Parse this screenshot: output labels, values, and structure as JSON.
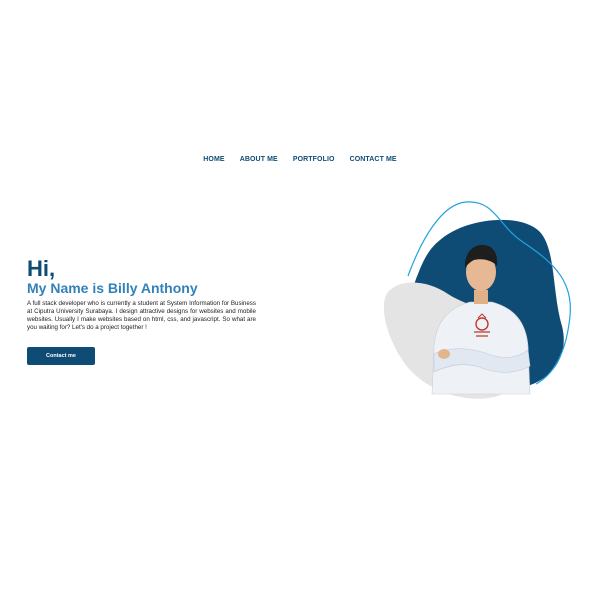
{
  "nav": {
    "items": [
      {
        "label": "HOME"
      },
      {
        "label": "ABOUT ME"
      },
      {
        "label": "PORTFOLIO"
      },
      {
        "label": "CONTACT ME"
      }
    ]
  },
  "hero": {
    "greeting": "Hi,",
    "name_line": "My Name is Billy Anthony",
    "description": "A full stack developer who is currently a student at System Information for Business at Ciputra University Surabaya. I design attractive designs for websites and mobile websites. Usually I make websites based on html, css, and javascript. So what are you waiting for? Let's do a project together !",
    "cta_label": "Contact me"
  },
  "colors": {
    "primary": "#0f4c75",
    "accent": "#3282b8",
    "outline": "#1fa3e0",
    "blob_grey": "#e4e4e4"
  },
  "icons": {
    "portrait": "profile-photo-icon"
  }
}
